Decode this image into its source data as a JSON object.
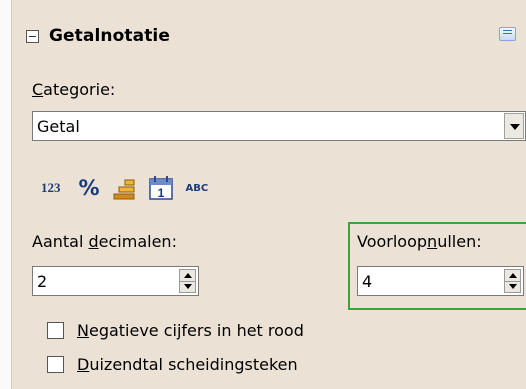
{
  "section": {
    "title": "Getalnotatie"
  },
  "category": {
    "label_accel": "C",
    "label_rest": "ategorie:",
    "value": "Getal"
  },
  "format_icons": [
    {
      "name": "number-format-icon",
      "text": "123"
    },
    {
      "name": "percent-format-icon",
      "text": "%"
    },
    {
      "name": "currency-format-icon"
    },
    {
      "name": "date-format-icon",
      "text": "1"
    },
    {
      "name": "text-format-icon",
      "text": "ABC"
    }
  ],
  "decimals": {
    "label_pre": "Aantal ",
    "label_accel": "d",
    "label_post": "ecimalen:",
    "value": "2"
  },
  "leading_zeros": {
    "label_pre": "Voorloop",
    "label_accel": "n",
    "label_post": "ullen:",
    "value": "4"
  },
  "negative_red": {
    "label_accel": "N",
    "label_rest": "egatieve cijfers in het rood",
    "checked": false
  },
  "thousands_sep": {
    "label_accel": "D",
    "label_rest": "uizendtal scheidingsteken",
    "checked": false
  }
}
